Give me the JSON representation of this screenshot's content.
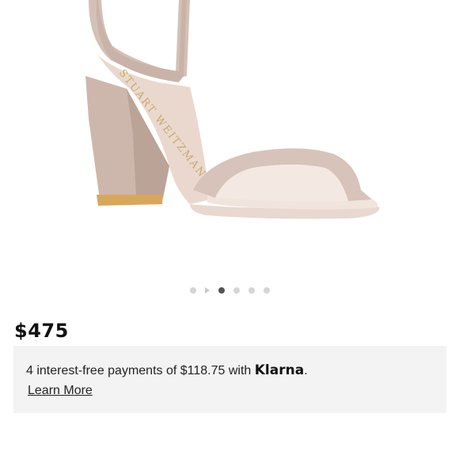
{
  "product": {
    "image_icon": "sandal-product-image",
    "insole_brand": "STUART WEITZMAN",
    "price": "$475"
  },
  "carousel": {
    "total_dots": 5,
    "active_index": 2
  },
  "klarna": {
    "message_prefix": "4 interest-free payments of $118.75 with ",
    "brand": "Klarna",
    "message_suffix": ".",
    "learn_more": "Learn More"
  },
  "colors": {
    "page_bg": "#ffffff",
    "klarna_bg": "#f3f3f3",
    "dot_inactive": "#d5d5d5",
    "dot_active": "#555555",
    "sandal_leather": "#d9c6bd"
  }
}
